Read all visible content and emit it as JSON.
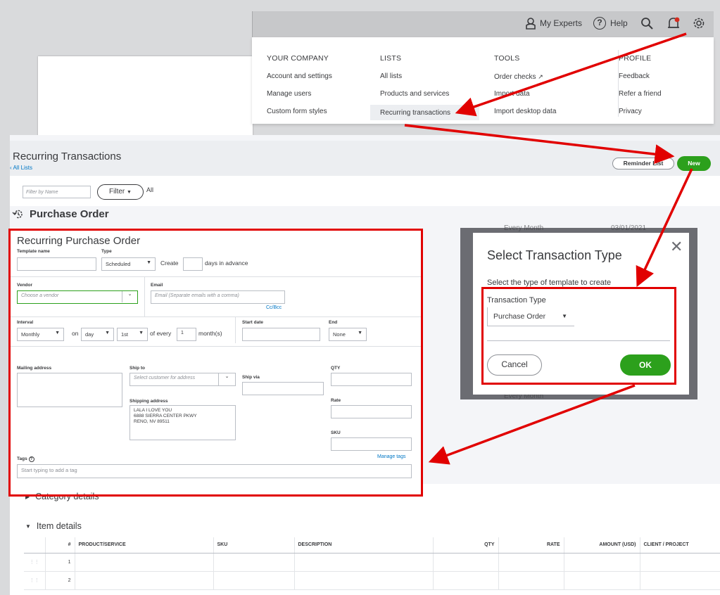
{
  "topbar": {
    "my_experts": "My Experts",
    "help": "Help"
  },
  "settings_menu": {
    "columns": [
      {
        "heading": "YOUR COMPANY",
        "items": [
          "Account and settings",
          "Manage users",
          "Custom form styles"
        ]
      },
      {
        "heading": "LISTS",
        "items": [
          "All lists",
          "Products and services",
          "Recurring transactions"
        ]
      },
      {
        "heading": "TOOLS",
        "items": [
          "Order checks",
          "Import data",
          "Import desktop data"
        ]
      },
      {
        "heading": "PROFILE",
        "items": [
          "Feedback",
          "Refer a friend",
          "Privacy"
        ]
      }
    ]
  },
  "page": {
    "title": "Recurring Transactions",
    "back_link": "All Lists",
    "reminder_list": "Reminder List",
    "new_button": "New",
    "filter_placeholder": "Filter by Name",
    "filter_button": "Filter",
    "filter_value": "All",
    "transaction_title": "Purchase Order"
  },
  "form": {
    "heading": "Recurring Purchase Order",
    "template_name_label": "Template name",
    "template_name_value": "",
    "type_label": "Type",
    "type_value": "Scheduled",
    "create_label": "Create",
    "days_in_advance": "days in advance",
    "vendor_label": "Vendor",
    "vendor_placeholder": "Choose a vendor",
    "email_label": "Email",
    "email_placeholder": "Email (Separate emails with a comma)",
    "cc_bcc": "Cc/Bcc",
    "interval_label": "Interval",
    "interval_value": "Monthly",
    "on_label": "on",
    "day_value": "day",
    "ordinal_value": "1st",
    "of_every_label": "of every",
    "every_value": "1",
    "months_label": "month(s)",
    "start_date_label": "Start date",
    "end_label": "End",
    "end_value": "None",
    "mailing_address_label": "Mailing address",
    "ship_to_label": "Ship to",
    "ship_to_placeholder": "Select customer for address",
    "ship_via_label": "Ship via",
    "shipping_address_label": "Shipping address",
    "shipping_address_lines": [
      "LALA I LOVE YOU",
      "6888 SIERRA CENTER PKWY",
      "RENO, NV  89511"
    ],
    "qty_label": "QTY",
    "rate_label": "Rate",
    "sku_label": "SKU",
    "tags_label": "Tags",
    "manage_tags": "Manage tags",
    "tags_placeholder": "Start typing to add a tag"
  },
  "details": {
    "category_details": "Category details",
    "item_details": "Item details",
    "columns": [
      "#",
      "PRODUCT/SERVICE",
      "SKU",
      "DESCRIPTION",
      "QTY",
      "RATE",
      "AMOUNT (USD)",
      "CLIENT / PROJECT"
    ],
    "rows": [
      "1",
      "2"
    ]
  },
  "background_list": {
    "first_text": "Every Month",
    "first_date": "03/01/2021",
    "last_text": "Every Month"
  },
  "modal": {
    "title": "Select Transaction Type",
    "description": "Select the type of template to create",
    "field_label": "Transaction Type",
    "selected": "Purchase Order",
    "cancel": "Cancel",
    "ok": "OK"
  },
  "colors": {
    "brand_green": "#2ca01c",
    "annotation_red": "#e10000",
    "link_blue": "#0077c5"
  }
}
